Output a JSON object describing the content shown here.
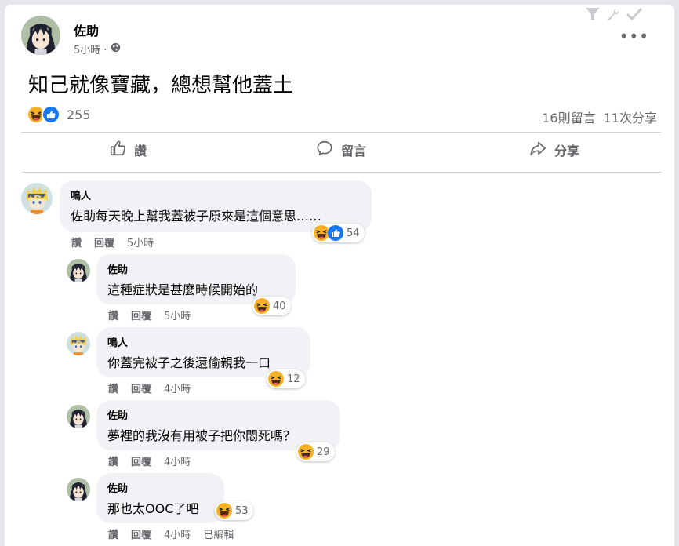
{
  "post": {
    "author": "佐助",
    "time": "5小時 ·",
    "more": "•••",
    "text": "知己就像寶藏，總想幫他蓋土",
    "reaction_count": "255",
    "comments_count": "16則留言",
    "shares_count": "11次分享"
  },
  "actions": {
    "like": "讚",
    "comment": "留言",
    "share": "分享"
  },
  "comments": [
    {
      "name": "鳴人",
      "text": "佐助每天晚上幫我蓋被子原來是這個意思……",
      "like": "讚",
      "reply": "回覆",
      "time": "5小時",
      "reactions": "54"
    },
    {
      "name": "佐助",
      "text": "這種症狀是甚麼時候開始的",
      "like": "讚",
      "reply": "回覆",
      "time": "5小時",
      "reactions": "40"
    },
    {
      "name": "鳴人",
      "text": "你蓋完被子之後還偷親我一口",
      "like": "讚",
      "reply": "回覆",
      "time": "4小時",
      "reactions": "12"
    },
    {
      "name": "佐助",
      "text": "夢裡的我沒有用被子把你悶死嗎？",
      "like": "讚",
      "reply": "回覆",
      "time": "4小時",
      "reactions": "29"
    },
    {
      "name": "佐助",
      "text": "那也太OOC了吧",
      "like": "讚",
      "reply": "回覆",
      "time": "4小時",
      "edited": "已編輯",
      "reactions": "53"
    }
  ],
  "colors": {
    "like_blue": "#1877f2",
    "haha_yellow": "#f7b125",
    "secondary_text": "#65676b"
  },
  "icons": [
    "filter-icon",
    "wrench-icon",
    "check-icon",
    "globe-icon",
    "haha-emoji-icon",
    "like-emoji-icon",
    "thumbs-up-icon",
    "speech-bubble-icon",
    "share-arrow-icon"
  ]
}
